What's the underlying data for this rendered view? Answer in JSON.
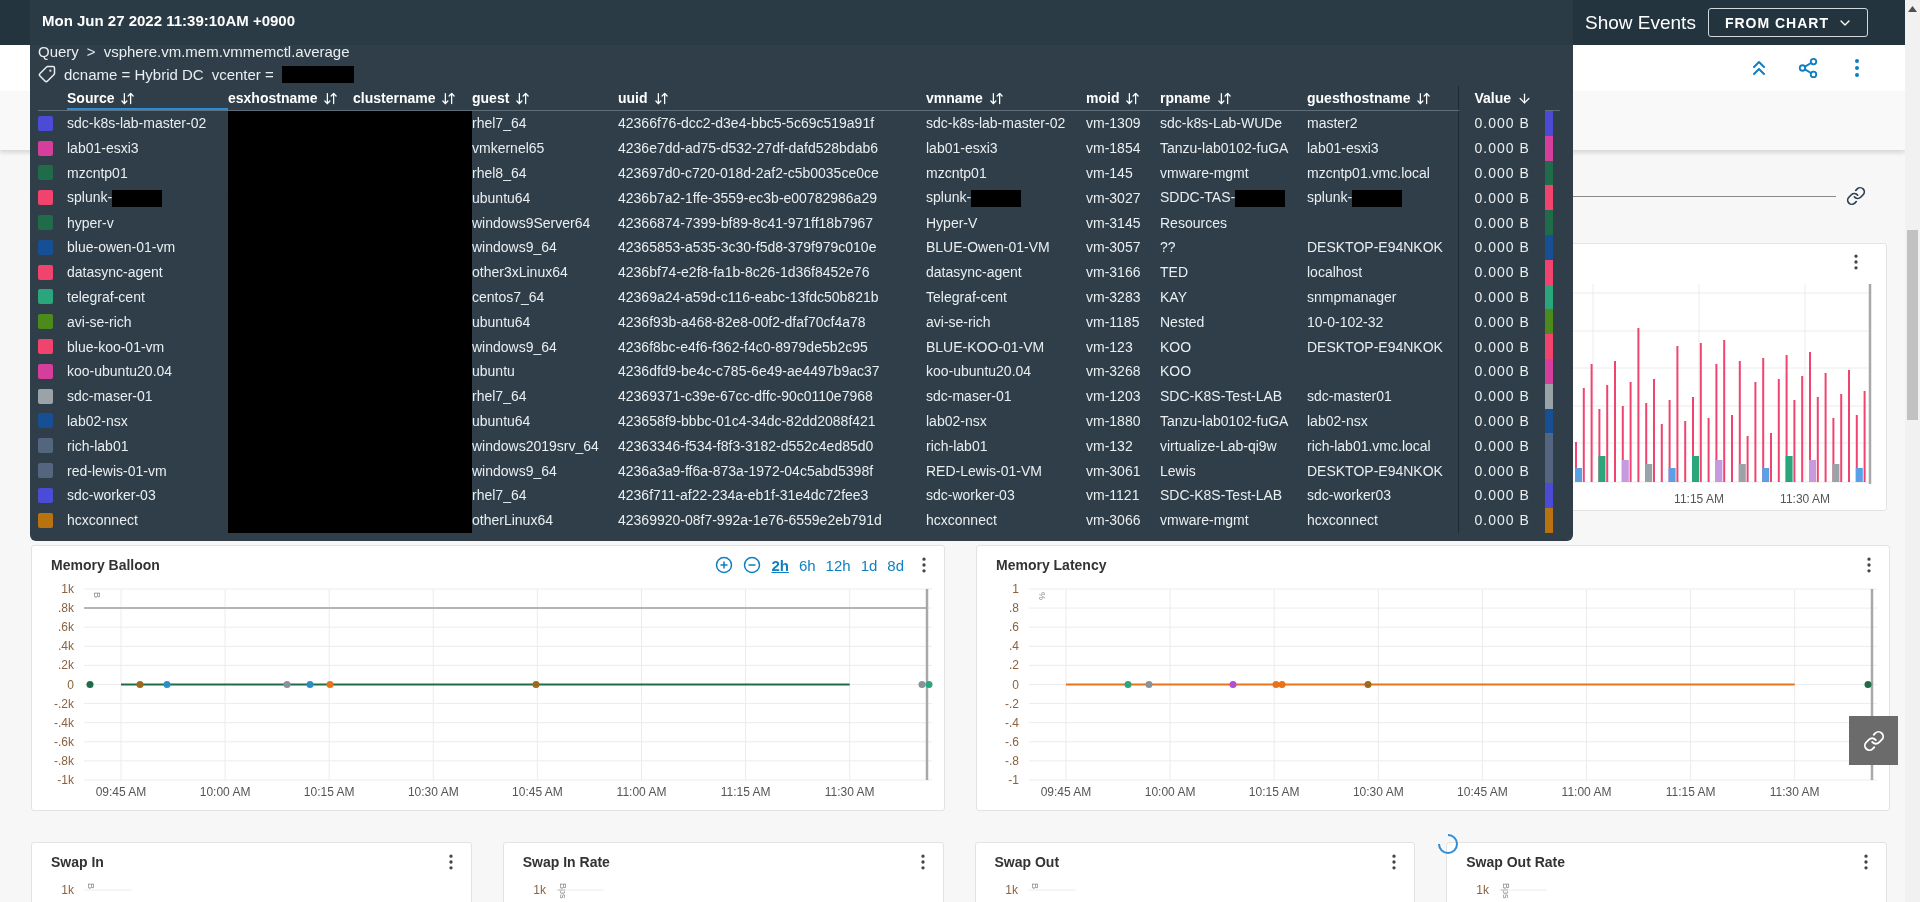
{
  "top_bar": {
    "show_events_label": "Show Events",
    "events_dropdown": "FROM CHART"
  },
  "tooltip": {
    "title": "Mon Jun 27 2022 11:39:10AM +0900",
    "query_label": "Query",
    "query_separator": ">",
    "query": "vsphere.vm.mem.vmmemctl.average",
    "tags": [
      {
        "text": "dcname = Hybrid DC",
        "redacted": false
      },
      {
        "text": "vcenter =",
        "redacted": true
      }
    ],
    "columns": [
      {
        "label": "Source",
        "sorted": false,
        "selected": true,
        "redacted": false
      },
      {
        "label": "esxhostname",
        "sorted": false,
        "selected": false,
        "redacted": true
      },
      {
        "label": "clustername",
        "sorted": false,
        "selected": false,
        "redacted": true
      },
      {
        "label": "guest",
        "sorted": false,
        "selected": false,
        "redacted": false
      },
      {
        "label": "uuid",
        "sorted": false,
        "selected": false,
        "redacted": false
      },
      {
        "label": "vmname",
        "sorted": false,
        "selected": false,
        "redacted": false
      },
      {
        "label": "moid",
        "sorted": false,
        "selected": false,
        "redacted": false
      },
      {
        "label": "rpname",
        "sorted": false,
        "selected": false,
        "redacted": false
      },
      {
        "label": "guesthostname",
        "sorted": false,
        "selected": false,
        "redacted": false
      },
      {
        "label": "Value",
        "sorted": true,
        "selected": false,
        "redacted": false
      }
    ],
    "rows": [
      {
        "color": "#4b4bd6",
        "cells": [
          "sdc-k8s-lab-master-02",
          "",
          "",
          "rhel7_64",
          "42366f76-dcc2-d3e4-bbc5-5c69c519a91f",
          "sdc-k8s-lab-master-02",
          "vm-1309",
          "sdc-k8s-Lab-WUDe",
          "master2",
          "0.000 B"
        ]
      },
      {
        "color": "#d63e9c",
        "cells": [
          "lab01-esxi3",
          "",
          "",
          "vmkernel65",
          "4236e7dd-ad75-d532-27df-dafd528bdab6",
          "lab01-esxi3",
          "vm-1854",
          "Tanzu-lab0102-fuGA",
          "lab01-esxi3",
          "0.000 B"
        ]
      },
      {
        "color": "#1f6b4a",
        "cells": [
          "mzcntp01",
          "",
          "",
          "rhel8_64",
          "423697d0-c720-018d-2af2-c5b0035ce0ce",
          "mzcntp01",
          "vm-145",
          "vmware-mgmt",
          "mzcntp01.vmc.local",
          "0.000 B"
        ]
      },
      {
        "color": "#f0446e",
        "cells": [
          {
            "text": "splunk-",
            "masked": true
          },
          "",
          "",
          "ubuntu64",
          "4236b7a2-1ffe-3559-ec3b-e00782986a29",
          {
            "text": "splunk-",
            "masked": true
          },
          "vm-3027",
          {
            "text": "SDDC-TAS-",
            "masked": true
          },
          {
            "text": "splunk-",
            "masked": true
          },
          "0.000 B"
        ]
      },
      {
        "color": "#1f6b4a",
        "cells": [
          "hyper-v",
          "",
          "",
          "windows9Server64",
          "42366874-7399-bf89-8c41-971ff18b7967",
          "Hyper-V",
          "vm-3145",
          "Resources",
          "",
          "0.000 B"
        ]
      },
      {
        "color": "#164f93",
        "cells": [
          "blue-owen-01-vm",
          "",
          "",
          "windows9_64",
          "42365853-a535-3c30-f5d8-379f979c010e",
          "BLUE-Owen-01-VM",
          "vm-3057",
          "??",
          "DESKTOP-E94NKOK",
          "0.000 B"
        ]
      },
      {
        "color": "#f0446e",
        "cells": [
          "datasync-agent",
          "",
          "",
          "other3xLinux64",
          "4236bf74-e2f8-fa1b-8c26-1d36f8452e76",
          "datasync-agent",
          "vm-3166",
          "TED",
          "localhost",
          "0.000 B"
        ]
      },
      {
        "color": "#2aa57c",
        "cells": [
          "telegraf-cent",
          "",
          "",
          "centos7_64",
          "42369a24-a59d-c116-eabc-13fdc50b821b",
          "Telegraf-cent",
          "vm-3283",
          "KAY",
          "snmpmanager",
          "0.000 B"
        ]
      },
      {
        "color": "#4d8a1c",
        "cells": [
          "avi-se-rich",
          "",
          "",
          "ubuntu64",
          "4236f93b-a468-82e8-00f2-dfaf70cf4a78",
          "avi-se-rich",
          "vm-1185",
          "Nested",
          "10-0-102-32",
          "0.000 B"
        ]
      },
      {
        "color": "#f0446e",
        "cells": [
          "blue-koo-01-vm",
          "",
          "",
          "windows9_64",
          "4236f8bc-e4f6-f362-f4c0-8979de5b2c95",
          "BLUE-KOO-01-VM",
          "vm-123",
          "KOO",
          "DESKTOP-E94NKOK",
          "0.000 B"
        ]
      },
      {
        "color": "#d63e9c",
        "cells": [
          "koo-ubuntu20.04",
          "",
          "",
          "ubuntu",
          "4236dfd9-be4c-c785-6e49-ae4497b9ac37",
          "koo-ubuntu20.04",
          "vm-3268",
          "KOO",
          "",
          "0.000 B"
        ]
      },
      {
        "color": "#9aa3a8",
        "cells": [
          "sdc-maser-01",
          "",
          "",
          "rhel7_64",
          "42369371-c39e-67cc-dffc-90c0110e7968",
          "sdc-maser-01",
          "vm-1203",
          "SDC-K8S-Test-LAB",
          "sdc-master01",
          "0.000 B"
        ]
      },
      {
        "color": "#164f93",
        "cells": [
          "lab02-nsx",
          "",
          "",
          "ubuntu64",
          "423658f9-bbbc-01c4-34dc-82dd2088f421",
          "lab02-nsx",
          "vm-1880",
          "Tanzu-lab0102-fuGA",
          "lab02-nsx",
          "0.000 B"
        ]
      },
      {
        "color": "#546580",
        "cells": [
          "rich-lab01",
          "",
          "",
          "windows2019srv_64",
          "42363346-f534-f8f3-3182-d552c4ed85d0",
          "rich-lab01",
          "vm-132",
          "virtualize-Lab-qi9w",
          "rich-lab01.vmc.local",
          "0.000 B"
        ]
      },
      {
        "color": "#546580",
        "cells": [
          "red-lewis-01-vm",
          "",
          "",
          "windows9_64",
          "4236a3a9-ff6a-873a-1972-04c5abd5398f",
          "RED-Lewis-01-VM",
          "vm-3061",
          "Lewis",
          "DESKTOP-E94NKOK",
          "0.000 B"
        ]
      },
      {
        "color": "#4b4bd6",
        "cells": [
          "sdc-worker-03",
          "",
          "",
          "rhel7_64",
          "4236f711-af22-234a-eb1f-31e4dc72fee3",
          "sdc-worker-03",
          "vm-1121",
          "SDC-K8S-Test-LAB",
          "sdc-worker03",
          "0.000 B"
        ]
      },
      {
        "color": "#b8720f",
        "cells": [
          "hcxconnect",
          "",
          "",
          "otherLinux64",
          "42369920-08f7-992a-1e76-6559e2eb791d",
          "hcxconnect",
          "vm-3066",
          "vmware-mgmt",
          "hcxconnect",
          "0.000 B"
        ]
      }
    ]
  },
  "chart_panel": {
    "x_labels": [
      "11:15 AM",
      "11:30 AM"
    ]
  },
  "charts": [
    {
      "title": "Memory Balloon",
      "ranges": [
        {
          "label": "2h",
          "selected": true
        },
        {
          "label": "6h",
          "selected": false
        },
        {
          "label": "12h",
          "selected": false
        },
        {
          "label": "1d",
          "selected": false
        },
        {
          "label": "8d",
          "selected": false
        }
      ],
      "chart_data": {
        "type": "line",
        "grid": true,
        "x": [
          "09:45 AM",
          "10:00 AM",
          "10:15 AM",
          "10:30 AM",
          "10:45 AM",
          "11:00 AM",
          "11:15 AM",
          "11:30 AM"
        ],
        "ylabel": "B",
        "ylim": [
          -1000,
          1000
        ],
        "yticks": [
          {
            "value": 1000,
            "label": "1k"
          },
          {
            "value": 800,
            "label": ".8k"
          },
          {
            "value": 600,
            "label": ".6k"
          },
          {
            "value": 400,
            "label": ".4k"
          },
          {
            "value": 200,
            "label": ".2k"
          },
          {
            "value": 0,
            "label": "0"
          },
          {
            "value": -200,
            "label": "-.2k"
          },
          {
            "value": -400,
            "label": "-.4k"
          },
          {
            "value": -600,
            "label": "-.6k"
          },
          {
            "value": -800,
            "label": "-.8k"
          },
          {
            "value": -1000,
            "label": "-1k"
          }
        ],
        "series": [
          {
            "color": "#1f6b4a",
            "values": [
              0,
              0,
              0,
              0,
              0,
              0,
              0,
              0
            ]
          }
        ]
      }
    },
    {
      "title": "Memory Latency",
      "chart_data": {
        "type": "line",
        "grid": true,
        "x": [
          "09:45 AM",
          "10:00 AM",
          "10:15 AM",
          "10:30 AM",
          "10:45 AM",
          "11:00 AM",
          "11:15 AM",
          "11:30 AM"
        ],
        "ylabel": "%",
        "ylim": [
          -1,
          1
        ],
        "yticks": [
          {
            "value": 1,
            "label": "1"
          },
          {
            "value": 0.8,
            "label": ".8"
          },
          {
            "value": 0.6,
            "label": ".6"
          },
          {
            "value": 0.4,
            "label": ".4"
          },
          {
            "value": 0.2,
            "label": ".2"
          },
          {
            "value": 0,
            "label": "0"
          },
          {
            "value": -0.2,
            "label": "-.2"
          },
          {
            "value": -0.4,
            "label": "-.4"
          },
          {
            "value": -0.6,
            "label": "-.6"
          },
          {
            "value": -0.8,
            "label": "-.8"
          },
          {
            "value": -1,
            "label": "-1"
          }
        ],
        "series": [
          {
            "color": "#e8731a",
            "values": [
              0,
              0,
              0,
              0,
              0,
              0,
              0,
              0
            ]
          }
        ]
      }
    }
  ],
  "swap_cards": [
    {
      "title": "Swap In",
      "ytick": "1k",
      "unit": "B",
      "loading": false
    },
    {
      "title": "Swap In Rate",
      "ytick": "1k",
      "unit": "Bps",
      "loading": false
    },
    {
      "title": "Swap Out",
      "ytick": "1k",
      "unit": "B",
      "loading": false
    },
    {
      "title": "Swap Out Rate",
      "ytick": "1k",
      "unit": "Bps",
      "loading": true
    }
  ]
}
